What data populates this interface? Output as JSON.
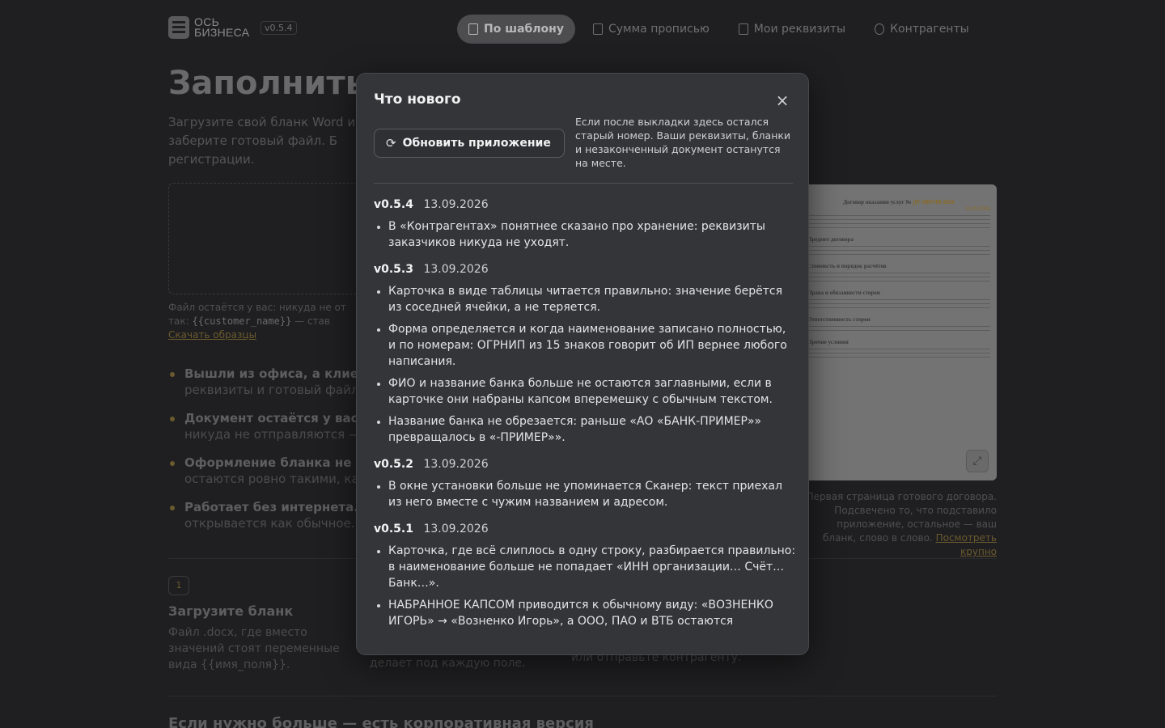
{
  "app": {
    "logo_line1": "ОСЬ",
    "logo_line2": "БИЗНЕСА",
    "version": "v0.5.4"
  },
  "nav": {
    "items": [
      {
        "label": "По шаблону",
        "active": true
      },
      {
        "label": "Сумма прописью",
        "active": false
      },
      {
        "label": "Мои реквизиты",
        "active": false
      },
      {
        "label": "Контрагенты",
        "active": false
      }
    ]
  },
  "background": {
    "title": "Заполнить",
    "subtitle": "Загрузите свой бланк Word и заберите готовый файл. Б регистрации.",
    "hint_prefix": "Файл остаётся у вас: никуда не от так:",
    "hint_code": "{{customer_name}}",
    "hint_suffix": "— став",
    "download_link": "Скачать образцы",
    "bullets": [
      {
        "title": "Вышли из офиса, а клие",
        "text": "реквизиты и готовый файл"
      },
      {
        "title": "Документ остаётся у вас",
        "text": "никуда не отправляются —"
      },
      {
        "title": "Оформление бланка не",
        "text": "остаются ровно такими, ка"
      },
      {
        "title": "Работает без интернета.",
        "text": "открывается как обычное."
      }
    ],
    "step_number": "1",
    "step_title": "Загрузите бланк",
    "step_text": "Файл .docx, где вместо значений стоят переменные вида {{имя_поля}}.",
    "step2_text": "делает под каждую поле.",
    "step3_text": "или отправьте контрагенту.",
    "bottom_title": "Если нужно больше — есть корпоративная версия",
    "preview_caption": "Первая страница готового договора. Подсвечено то, что подставило приложение, остальное — ваш бланк, слово в слово.",
    "preview_link": "Посмотреть крупно",
    "preview_doc_title": "Договор оказания услуг №",
    "preview_doc_number": "ДУ-0007/09-2026",
    "preview_doc_date": "12.09.2026",
    "preview_sections": [
      "Предмет договора",
      "Стоимость и порядок расчётов",
      "Права и обязанности сторон",
      "Ответственность сторон",
      "Прочие условия"
    ]
  },
  "modal": {
    "title": "Что нового",
    "close_symbol": "×",
    "update_button": "Обновить приложение",
    "update_note": "Если после выкладки здесь остался старый номер. Ваши реквизиты, бланки и незаконченный документ останутся на месте.",
    "releases": [
      {
        "version": "v0.5.4",
        "date": "13.09.2026",
        "items": [
          "В «Контрагентах» понятнее сказано про хранение: реквизиты заказчиков никуда не уходят."
        ]
      },
      {
        "version": "v0.5.3",
        "date": "13.09.2026",
        "items": [
          "Карточка в виде таблицы читается правильно: значение берётся из соседней ячейки, а не теряется.",
          "Форма определяется и когда наименование записано полностью, и по номерам: ОГРНИП из 15 знаков говорит об ИП вернее любого написания.",
          "ФИО и название банка больше не остаются заглавными, если в карточке они набраны капсом вперемешку с обычным текстом.",
          "Название банка не обрезается: раньше «АО «БАНК-ПРИМЕР»» превращалось в «-ПРИМЕР»»."
        ]
      },
      {
        "version": "v0.5.2",
        "date": "13.09.2026",
        "items": [
          "В окне установки больше не упоминается Сканер: текст приехал из него вместе с чужим названием и адресом."
        ]
      },
      {
        "version": "v0.5.1",
        "date": "13.09.2026",
        "items": [
          "Карточка, где всё слиплось в одну строку, разбирается правильно: в наименование больше не попадает «ИНН организации… Счёт… Банк…».",
          "НАБРАННОЕ КАПСОМ приводится к обычному виду: «ВОЗНЕНКО ИГОРЬ» → «Возненко Игорь», а ООО, ПАО и ВТБ остаются"
        ]
      }
    ]
  }
}
